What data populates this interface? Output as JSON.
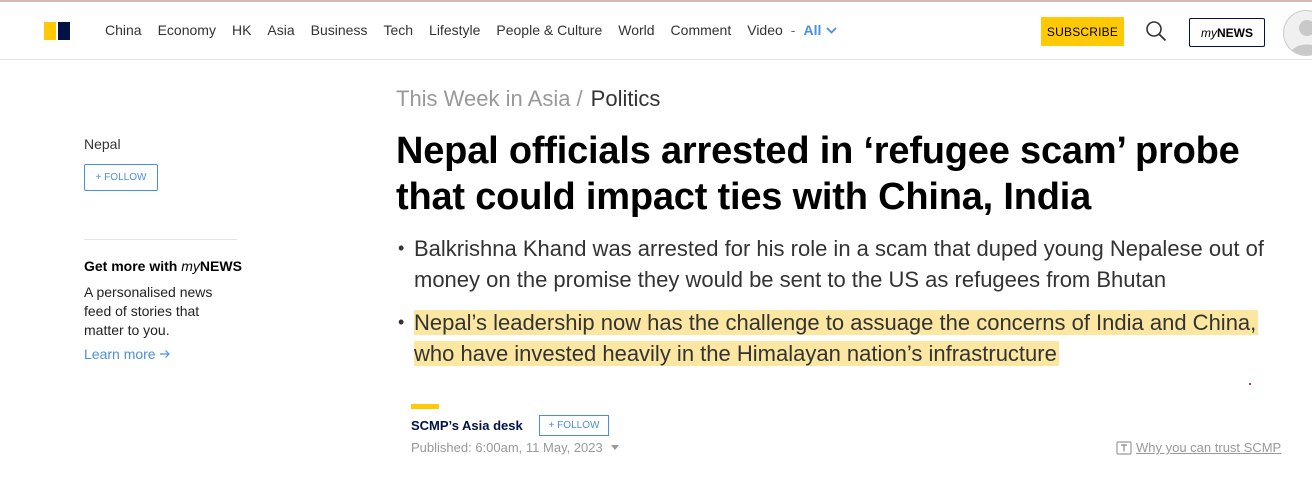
{
  "header": {
    "nav_items": [
      "China",
      "Economy",
      "HK",
      "Asia",
      "Business",
      "Tech",
      "Lifestyle",
      "People & Culture",
      "World",
      "Comment",
      "Video"
    ],
    "separator": "-",
    "all_label": "All",
    "subscribe_label": "SUBSCRIBE",
    "mynews_my": "my",
    "mynews_news": "NEWS"
  },
  "sidebar": {
    "topic": "Nepal",
    "follow_label": "+ FOLLOW",
    "promo_title_prefix": "Get more with ",
    "promo_title_my": "my",
    "promo_title_news": "NEWS",
    "promo_desc": "A personalised news feed of stories that matter to you.",
    "learn_more": "Learn more"
  },
  "article": {
    "breadcrumb_section": "This Week in Asia /",
    "breadcrumb_current": "Politics",
    "headline": "Nepal officials arrested in ‘refugee scam’ probe that could impact ties with China, India",
    "bullets": [
      "Balkrishna Khand was arrested for his role in a scam that duped young Nepalese out of money on the promise they would be sent to the US as refugees from Bhutan",
      "Nepal’s leadership now has the challenge to assuage the concerns of India and China, who have invested heavily in the Himalayan nation’s infrastructure"
    ],
    "author": "SCMP’s Asia desk",
    "author_follow_label": "+ FOLLOW",
    "published": "Published: 6:00am, 11 May, 2023",
    "trust_link": "Why you can trust SCMP"
  },
  "colors": {
    "accent_yellow": "#ffca05",
    "brand_navy": "#001246",
    "link_blue": "#4a90e2",
    "highlight": "#fbe7a1"
  }
}
